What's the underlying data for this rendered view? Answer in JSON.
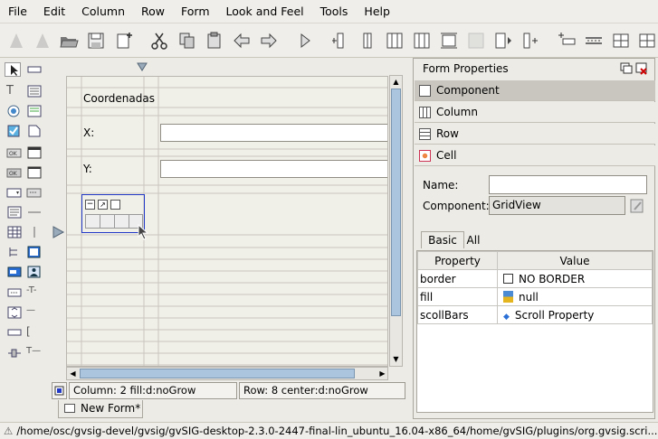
{
  "menu": [
    "File",
    "Edit",
    "Column",
    "Row",
    "Form",
    "Look and Feel",
    "Tools",
    "Help"
  ],
  "toolbar_icons": [
    "new-form-icon",
    "new-form-disabled-icon",
    "open-folder-icon",
    "save-icon",
    "new-file-icon",
    "cut-icon",
    "copy-icon",
    "paste-icon",
    "undo-icon",
    "redo-icon",
    "run-icon",
    "insert-column-left-icon",
    "insert-column-icon",
    "insert-column-right-icon",
    "insert-row-icon",
    "insert-row-above-icon",
    "merge-disabled-icon",
    "insert-after-icon",
    "insert-before-icon",
    "insert-row-below-icon",
    "row-icon",
    "grid-icon",
    "table-icon"
  ],
  "form": {
    "title_label": "Coordenadas",
    "x_label": "X:",
    "y_label": "Y:",
    "status_column": "Column:  2  fill:d:noGrow",
    "status_row": "Row:  8  center:d:noGrow",
    "tab": "New Form*"
  },
  "props": {
    "title": "Form Properties",
    "sections": [
      "Component",
      "Column",
      "Row",
      "Cell"
    ],
    "name_label": "Name:",
    "name_value": "",
    "component_label": "Component:",
    "component_value": "GridView",
    "tabs": [
      "Basic",
      "All"
    ],
    "header_property": "Property",
    "header_value": "Value",
    "rows": [
      {
        "property": "border",
        "value": "NO BORDER"
      },
      {
        "property": "fill",
        "value": "null"
      },
      {
        "property": "scollBars",
        "value": "Scroll Property"
      }
    ]
  },
  "statusline": "/home/osc/gvsig-devel/gvsig/gvSIG-desktop-2.3.0-2447-final-lin_ubuntu_16.04-x86_64/home/gvSIG/plugins/org.gvsig.scri..."
}
